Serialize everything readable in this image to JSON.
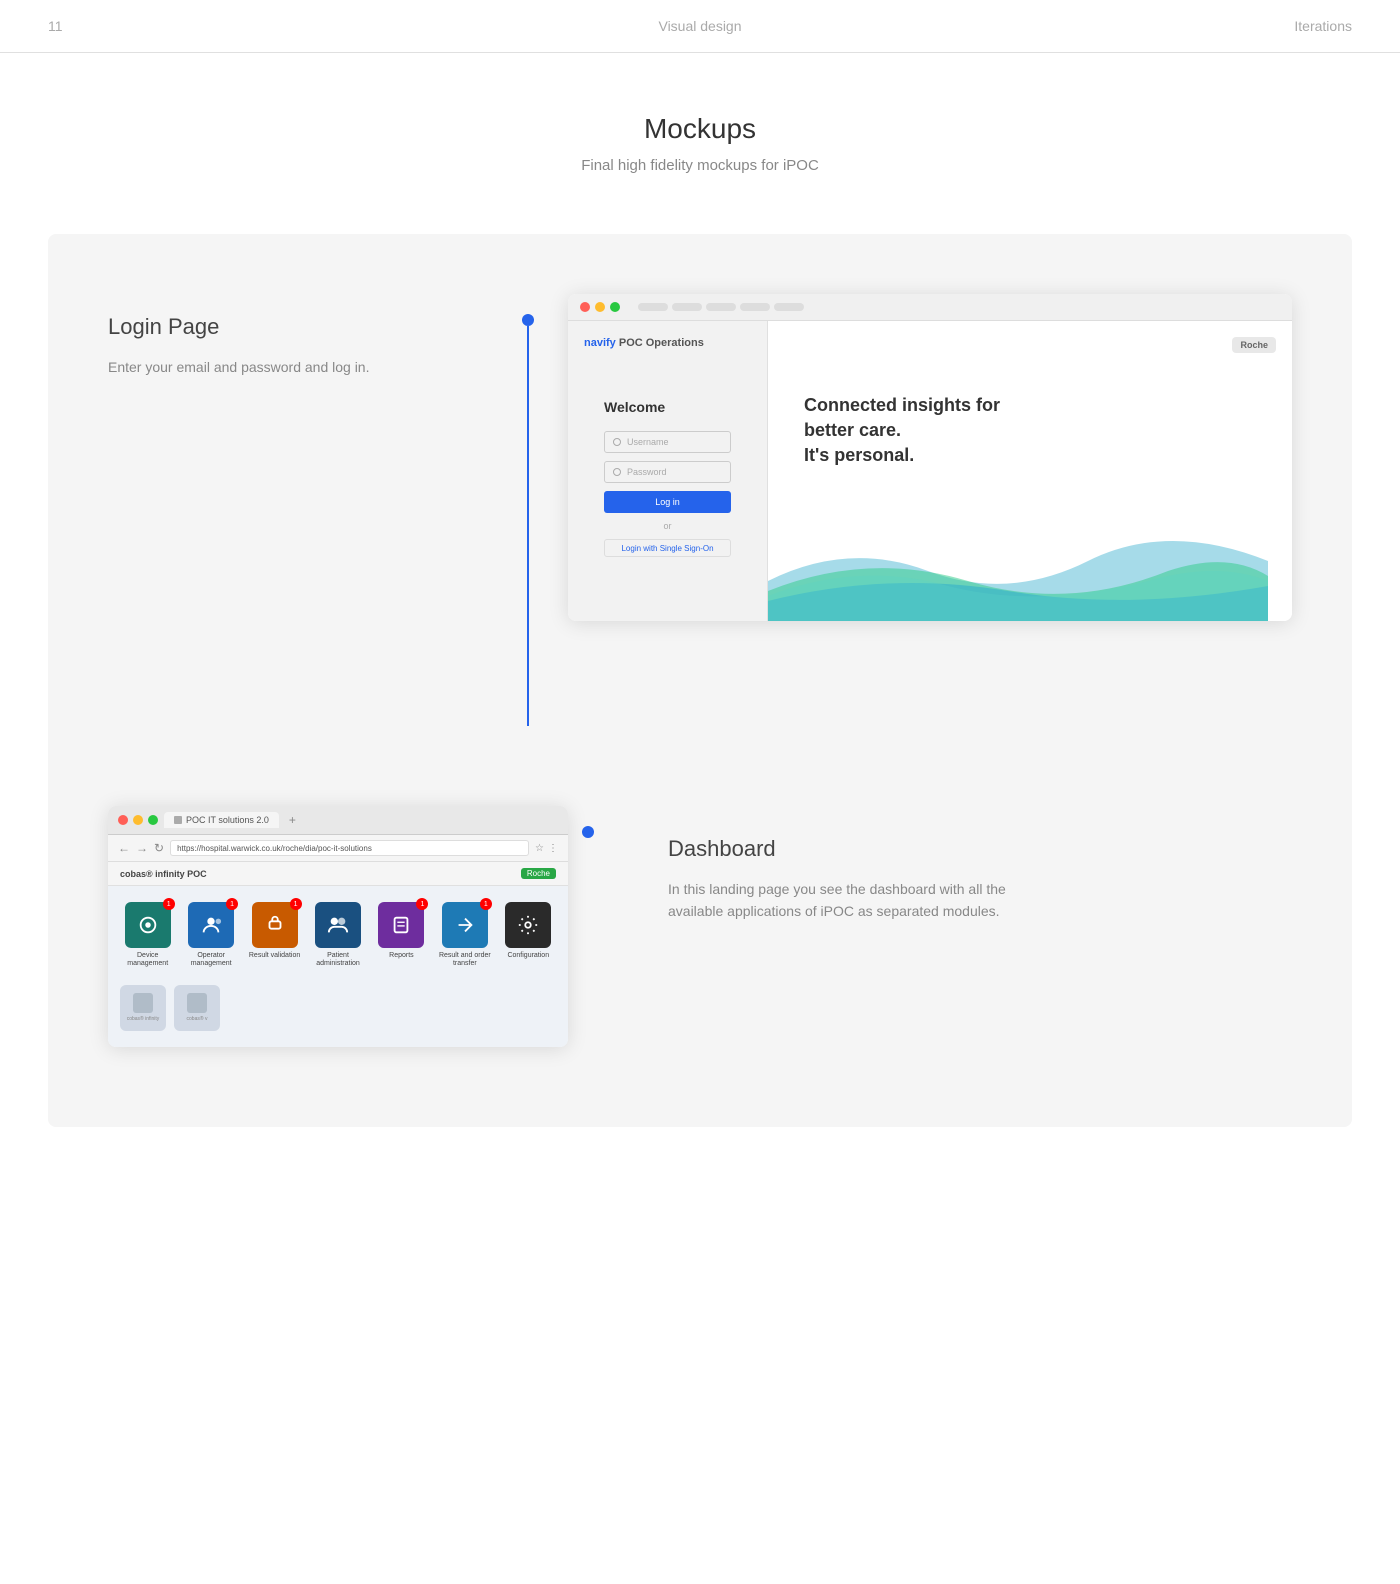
{
  "header": {
    "number": "11",
    "title": "Visual design",
    "label": "Iterations"
  },
  "section": {
    "heading": "Mockups",
    "subheading": "Final high fidelity mockups for iPOC"
  },
  "login": {
    "title": "Login Page",
    "description": "Enter your email and password and log in.",
    "brand": "navify POC Operations",
    "welcome": "Welcome",
    "username_placeholder": "Username",
    "password_placeholder": "Password",
    "login_btn": "Log in",
    "or_text": "or",
    "sso_text": "Login with Single Sign-On",
    "tagline_line1": "Connected insights for",
    "tagline_line2": "better care.",
    "tagline_line3": "It's personal.",
    "roche_label": "Roche"
  },
  "dashboard": {
    "title": "Dashboard",
    "description": "In this landing page you see the dashboard with all the available applications of iPOC as separated modules.",
    "brand": "cobas® infinity POC",
    "url": "https://hospital.warwick.co.uk/roche/dia/poc-it-solutions",
    "tab_label": "POC IT solutions 2.0",
    "modules": [
      {
        "label": "Device management",
        "color": "#1a7a6e",
        "badge": true
      },
      {
        "label": "Operator management",
        "color": "#1e6ab5",
        "badge": true
      },
      {
        "label": "Result validation",
        "color": "#c85a00",
        "badge": true
      },
      {
        "label": "Patient administration",
        "color": "#1a5080",
        "badge": false
      },
      {
        "label": "Reports",
        "color": "#6e2d9e",
        "badge": true
      },
      {
        "label": "Result and order transfer",
        "color": "#1e7ab5",
        "badge": true
      },
      {
        "label": "Configuration",
        "color": "#2a2a2a",
        "badge": false
      }
    ],
    "small_modules": [
      {
        "label": "cobas® infinity"
      },
      {
        "label": "cobas® v"
      }
    ]
  }
}
